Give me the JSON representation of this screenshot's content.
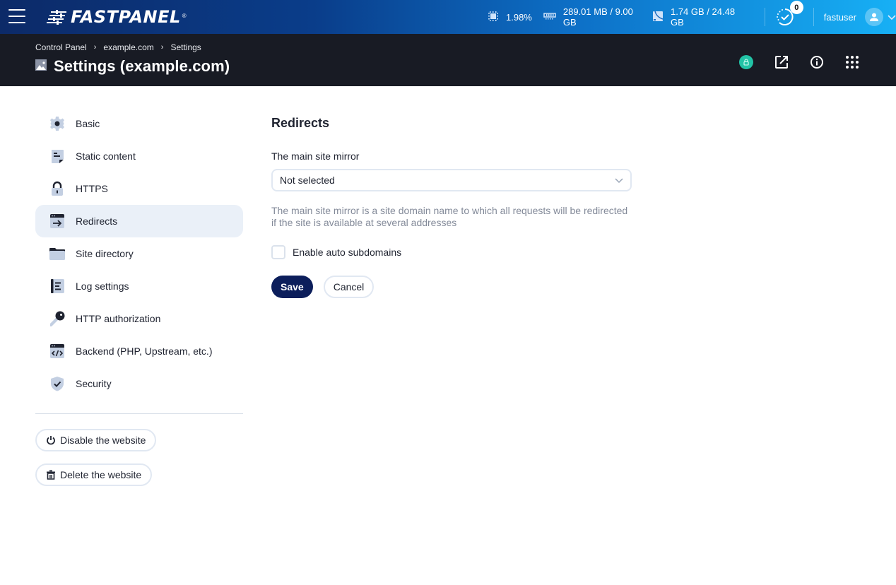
{
  "app": {
    "brand": "FASTPANEL",
    "brand_mark": "®"
  },
  "topbar": {
    "stats": [
      {
        "icon": "cpu-icon",
        "value": "1.98%"
      },
      {
        "icon": "memory-icon",
        "value": "289.01 MB / 9.00 GB"
      },
      {
        "icon": "disk-icon",
        "value": "1.74 GB / 24.48 GB"
      }
    ],
    "tasks_badge": "0",
    "username": "fastuser"
  },
  "header": {
    "breadcrumb": [
      "Control Panel",
      "example.com",
      "Settings"
    ],
    "title": "Settings (example.com)",
    "ssl_color": "#22c3a6"
  },
  "sidebar": {
    "items": [
      {
        "label": "Basic",
        "icon": "gear-icon",
        "active": false
      },
      {
        "label": "Static content",
        "icon": "document-icon",
        "active": false
      },
      {
        "label": "HTTPS",
        "icon": "lock-icon",
        "active": false
      },
      {
        "label": "Redirects",
        "icon": "redirect-icon",
        "active": true
      },
      {
        "label": "Site directory",
        "icon": "folder-icon",
        "active": false
      },
      {
        "label": "Log settings",
        "icon": "log-icon",
        "active": false
      },
      {
        "label": "HTTP authorization",
        "icon": "key-icon",
        "active": false
      },
      {
        "label": "Backend (PHP, Upstream, etc.)",
        "icon": "code-window-icon",
        "active": false
      },
      {
        "label": "Security",
        "icon": "shield-icon",
        "active": false
      }
    ],
    "disable_label": "Disable the website",
    "delete_label": "Delete the website"
  },
  "main": {
    "title": "Redirects",
    "mirror_label": "The main site mirror",
    "mirror_value": "Not selected",
    "mirror_hint_line1": "The main site mirror is a site domain name to which all requests will be redirected",
    "mirror_hint_line2": "if the site is available at several addresses",
    "auto_subdomains_label": "Enable auto subdomains",
    "auto_subdomains_checked": false,
    "save_label": "Save",
    "cancel_label": "Cancel"
  },
  "colors": {
    "primary_button": "#0c1e5b",
    "active_nav_bg": "#eaf0f8",
    "header_bg": "#181b24",
    "icon_fill": "#c3cfe2",
    "icon_dark": "#1f2330"
  }
}
